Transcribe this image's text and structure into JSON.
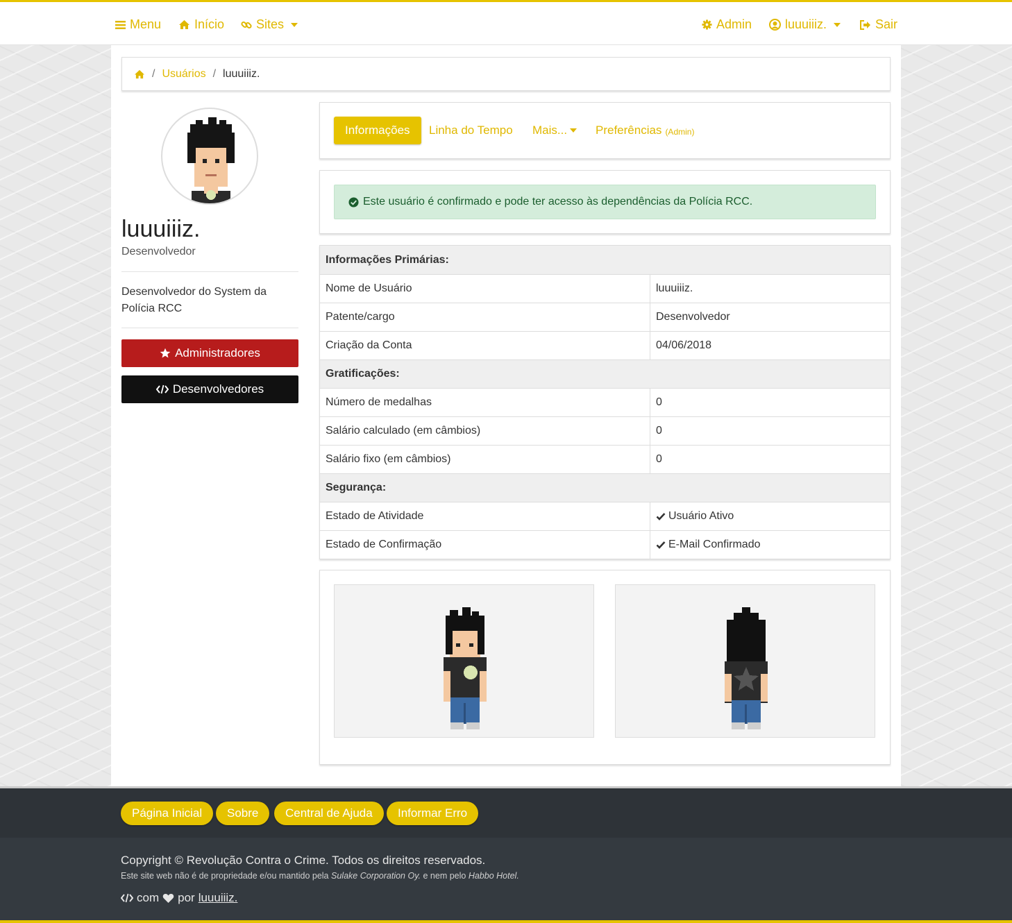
{
  "colors": {
    "accent": "#e6c300",
    "admin_btn": "#b71c1c",
    "dev_btn": "#111111",
    "alert_bg": "#d4eddb",
    "footer": "#343a40"
  },
  "navbar": {
    "menu": "Menu",
    "inicio": "Início",
    "sites": "Sites",
    "admin": "Admin",
    "user": "luuuiiiz.",
    "sair": "Sair"
  },
  "breadcrumb": {
    "users": "Usuários",
    "current": "luuuiiiz."
  },
  "profile": {
    "name": "luuuiiiz.",
    "role": "Desenvolvedor",
    "bio": "Desenvolvedor do System da Polícia RCC",
    "buttons": {
      "admins": "Administradores",
      "devs": "Desenvolvedores"
    }
  },
  "tabs": {
    "info": "Informações",
    "timeline": "Linha do Tempo",
    "more": "Mais...",
    "prefs": "Preferências",
    "prefs_tag": "(Admin)"
  },
  "alert": "Este usuário é confirmado e pode ter acesso às dependências da Polícia RCC.",
  "table": {
    "primary": {
      "title": "Informações Primárias:",
      "rows": [
        {
          "label": "Nome de Usuário",
          "value": "luuuiiiz."
        },
        {
          "label": "Patente/cargo",
          "value": "Desenvolvedor"
        },
        {
          "label": "Criação da Conta",
          "value": "04/06/2018"
        }
      ]
    },
    "grat": {
      "title": "Gratificações:",
      "rows": [
        {
          "label": "Número de medalhas",
          "value": "0"
        },
        {
          "label": "Salário calculado (em câmbios)",
          "value": "0"
        },
        {
          "label": "Salário fixo (em câmbios)",
          "value": "0"
        }
      ]
    },
    "security": {
      "title": "Segurança:",
      "rows": [
        {
          "label": "Estado de Atividade",
          "value": "Usuário Ativo"
        },
        {
          "label": "Estado de Confirmação",
          "value": "E-Mail Confirmado"
        }
      ]
    }
  },
  "footer": {
    "links": [
      "Página Inicial",
      "Sobre",
      "Central de Ajuda",
      "Informar Erro"
    ],
    "copyright": "Copyright © Revolução Contra o Crime. Todos os direitos reservados.",
    "disclaimer_prefix": "Este site web não é de propriedade e/ou mantido pela",
    "disclaimer_company": "Sulake Corporation Oy.",
    "disclaimer_mid": "e nem pelo",
    "disclaimer_hotel": "Habbo Hotel.",
    "made_com": "com",
    "made_por": "por",
    "author": "luuuiiiz."
  }
}
